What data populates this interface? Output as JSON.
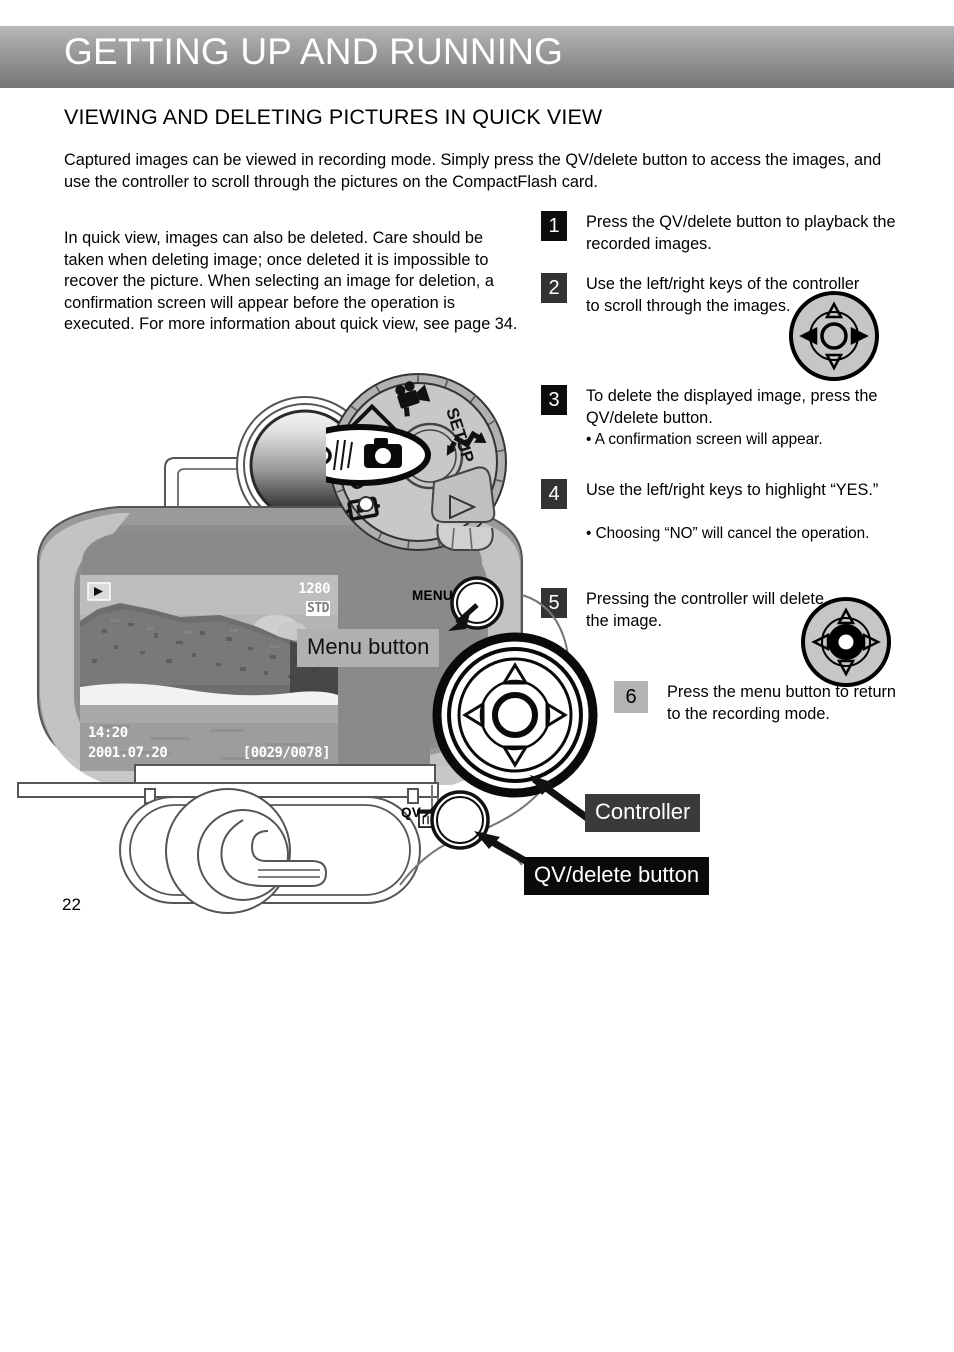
{
  "header": {
    "title": "GETTING UP AND RUNNING"
  },
  "section": {
    "title": "VIEWING AND DELETING PICTURES IN QUICK VIEW"
  },
  "body": {
    "para1": "Captured images can be viewed in recording mode. Simply press the QV/delete button to access the images, and use the controller to scroll through the pictures on the CompactFlash card.",
    "para2": "In quick view, images can also be deleted. Care should be taken when deleting image; once deleted it is impossible to recover the picture. When selecting an image for deletion, a confirmation screen will appear before the operation is executed. For more information about quick view, see page 34."
  },
  "steps": [
    {
      "num": "1",
      "text": "Press the QV/delete button to playback the recorded images.",
      "sub": ""
    },
    {
      "num": "2",
      "text": "Use the left/right keys of the controller to scroll through the images.",
      "sub": ""
    },
    {
      "num": "3",
      "text": "To delete the displayed image, press the QV/delete button.",
      "sub": "• A confirmation screen will appear."
    },
    {
      "num": "4",
      "text": "Use the left/right keys to highlight “YES.”",
      "sub": "• Choosing “NO” will cancel the operation."
    },
    {
      "num": "5",
      "text": "Pressing the controller will delete the image.",
      "sub": ""
    },
    {
      "num": "6",
      "text": "Press the menu button to return to the recording mode.",
      "sub": ""
    }
  ],
  "callouts": {
    "menu_button": "Menu button",
    "controller": "Controller",
    "qv_delete_button": "QV/delete button"
  },
  "camera_labels": {
    "menu": "MENU",
    "qv": "QV",
    "dial_off": "OFF",
    "dial_setup": "SETUP"
  },
  "lcd": {
    "resolution": "1280",
    "quality": "STD",
    "time": "14:20",
    "date": "2001.07.20",
    "counter": "[0029/0078]"
  },
  "page_number": "22",
  "colors": {
    "header_top": "#b9b9bc",
    "header_bottom": "#767679",
    "step_box_dark": "#0d0d0d",
    "step_box_mid": "#333333",
    "step_box_light": "#b3b3b3",
    "callout_menu_bg": "#b0b0b0",
    "callout_controller_bg": "#3a3a3a",
    "callout_qv_bg": "#0a0a0a",
    "camera_body": "#9a9a9a",
    "dial_face": "#c8c8c8"
  }
}
